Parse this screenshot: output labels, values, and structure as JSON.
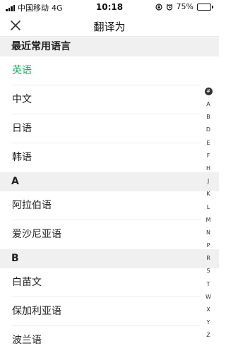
{
  "status_bar": {
    "carrier": "中国移动",
    "network": "4G",
    "time": "10:18",
    "battery_percent": "75%",
    "battery_level": 0.75,
    "icons": [
      "signal-icon",
      "lock-rotation-icon",
      "alarm-icon",
      "battery-icon"
    ]
  },
  "nav": {
    "title": "翻译为",
    "close_icon": "close-icon"
  },
  "sections": [
    {
      "header": "最近常用语言",
      "items": [
        "英语",
        "中文",
        "日语",
        "韩语"
      ],
      "selected": 0
    },
    {
      "header": "A",
      "items": [
        "阿拉伯语",
        "爱沙尼亚语"
      ]
    },
    {
      "header": "B",
      "items": [
        "白苗文",
        "保加利亚语",
        "波兰语"
      ]
    }
  ],
  "index_bar": {
    "hash": "#",
    "letters": [
      "A",
      "B",
      "D",
      "E",
      "F",
      "H",
      "J",
      "K",
      "L",
      "M",
      "N",
      "P",
      "R",
      "S",
      "T",
      "W",
      "X",
      "Y",
      "Z"
    ]
  },
  "colors": {
    "accent": "#1aad5f",
    "section_bg": "#f0f0f0",
    "battery": "#3cc13c"
  }
}
